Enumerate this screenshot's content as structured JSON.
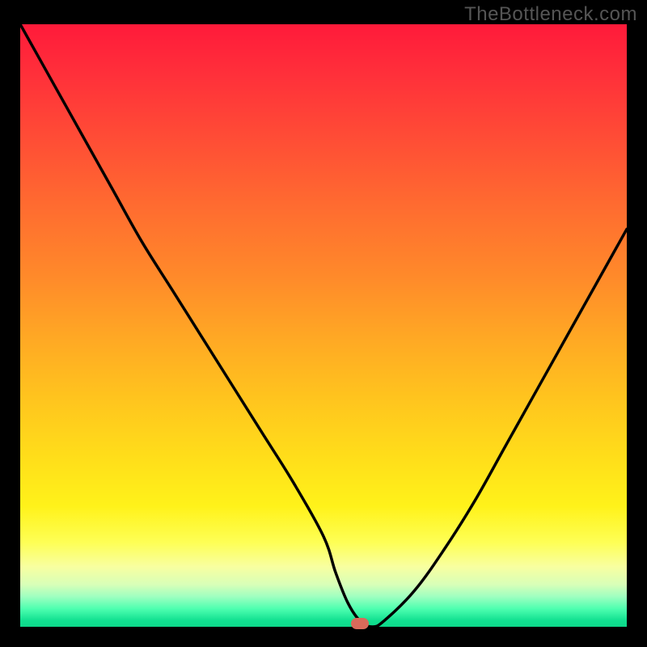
{
  "watermark": "TheBottleneck.com",
  "chart_data": {
    "type": "line",
    "title": "",
    "xlabel": "",
    "ylabel": "",
    "xlim": [
      0,
      100
    ],
    "ylim": [
      0,
      100
    ],
    "series": [
      {
        "name": "bottleneck-curve",
        "x": [
          0,
          5,
          10,
          15,
          20,
          25,
          30,
          35,
          40,
          45,
          50,
          52,
          54,
          56,
          58,
          60,
          65,
          70,
          75,
          80,
          85,
          90,
          95,
          100
        ],
        "y": [
          100,
          91,
          82,
          73,
          64,
          56,
          48,
          40,
          32,
          24,
          15,
          9,
          4,
          1,
          0,
          1,
          6,
          13,
          21,
          30,
          39,
          48,
          57,
          66
        ]
      }
    ],
    "marker": {
      "x": 56,
      "y": 0
    },
    "background_gradient": {
      "stops": [
        {
          "pos": 0,
          "color": "#ff1a3a"
        },
        {
          "pos": 50,
          "color": "#ffa824"
        },
        {
          "pos": 80,
          "color": "#fff21a"
        },
        {
          "pos": 100,
          "color": "#0ed88a"
        }
      ]
    }
  }
}
